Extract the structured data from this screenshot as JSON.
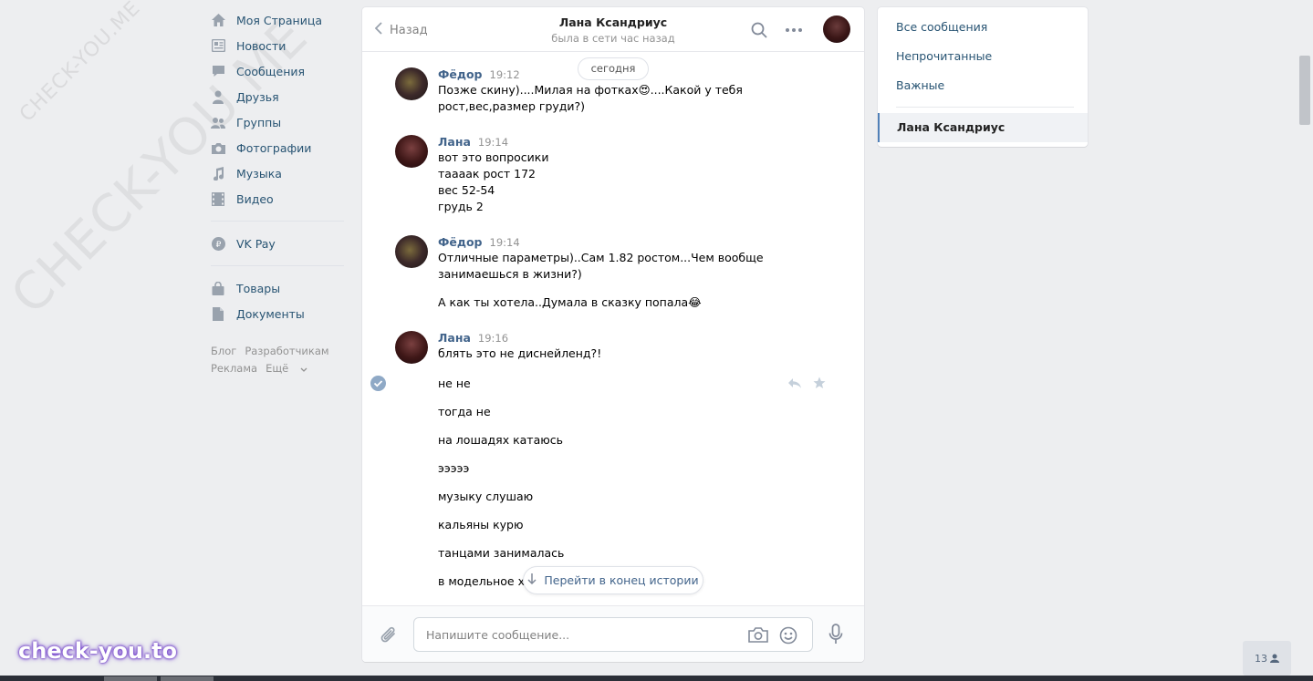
{
  "watermarks": {
    "diagonal_large": "CHECK-YOU.ME",
    "diagonal_small": "CHECK-YOU.ME",
    "bottom_logo": "check-you.to"
  },
  "leftnav": {
    "items": [
      {
        "label": "Моя Страница",
        "icon": "home-icon"
      },
      {
        "label": "Новости",
        "icon": "news-icon"
      },
      {
        "label": "Сообщения",
        "icon": "messages-icon"
      },
      {
        "label": "Друзья",
        "icon": "friends-icon"
      },
      {
        "label": "Группы",
        "icon": "groups-icon"
      },
      {
        "label": "Фотографии",
        "icon": "photos-icon"
      },
      {
        "label": "Музыка",
        "icon": "music-icon"
      },
      {
        "label": "Видео",
        "icon": "video-icon"
      }
    ],
    "vkpay": {
      "label": "VK Pay",
      "icon": "vkpay-icon"
    },
    "extra": [
      {
        "label": "Товары",
        "icon": "goods-icon"
      },
      {
        "label": "Документы",
        "icon": "documents-icon"
      }
    ],
    "footer": {
      "blog": "Блог",
      "developers": "Разработчикам",
      "ads": "Реклама",
      "more": "Ещё"
    }
  },
  "chat": {
    "back_label": "Назад",
    "peer_name": "Лана Ксандриус",
    "peer_status": "была в сети час назад",
    "date_label": "сегодня",
    "messages": [
      {
        "author": "Фёдор",
        "time": "19:12",
        "lines": [
          "Позже скину)....Милая на фотках😍....Какой у тебя",
          "рост,вес,размер груди?)"
        ]
      },
      {
        "author": "Лана",
        "time": "19:14",
        "lines": [
          "вот это вопросики",
          "таааак рост 172",
          "вес 52-54",
          "грудь 2"
        ]
      },
      {
        "author": "Фёдор",
        "time": "19:14",
        "lines": [
          "Отличные параметры)..Сам 1.82 ростом...Чем вообще",
          "занимаешься в жизни?)"
        ]
      },
      {
        "author": "Лана",
        "time": "19:16",
        "lines": [
          "блять это не диснейленд?!"
        ]
      }
    ],
    "extra_fedor": "А как ты хотела..Думала в сказку попала😂",
    "lana_followups": [
      "не не",
      "тогда не",
      "на лошадях катаюсь",
      "эээээ",
      "музыку слушаю",
      "кальяны курю",
      "танцами занималась",
      "в модельное хо"
    ],
    "jump_label": "Перейти в конец истории",
    "composer_placeholder": "Напишите сообщение..."
  },
  "rightpanel": {
    "filters": [
      "Все сообщения",
      "Непрочитанные",
      "Важные"
    ],
    "active_dialog": "Лана Ксандриус"
  },
  "counter": "13"
}
